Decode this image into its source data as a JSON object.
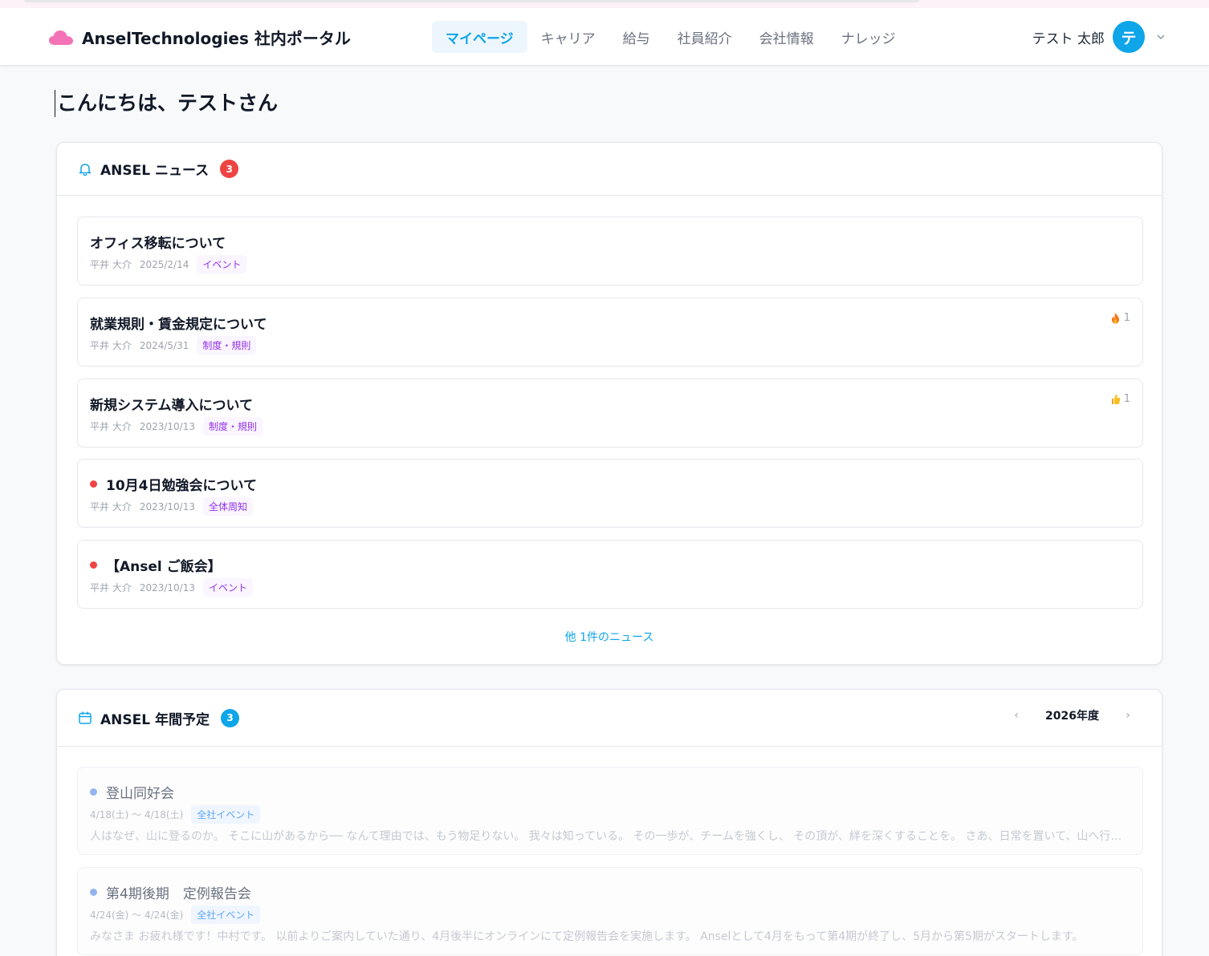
{
  "header": {
    "app_title": "AnselTechnologies 社内ポータル",
    "nav": [
      {
        "label": "マイページ",
        "active": true
      },
      {
        "label": "キャリア"
      },
      {
        "label": "給与"
      },
      {
        "label": "社員紹介"
      },
      {
        "label": "会社情報"
      },
      {
        "label": "ナレッジ"
      }
    ],
    "user_name": "テスト 太郎",
    "avatar_initial": "テ",
    "logo_icon": "cloud-icon",
    "accent_color": "#0ea5e9",
    "logo_color": "#f472b6"
  },
  "greeting": "こんにちは、テストさん",
  "news": {
    "title": "ANSEL ニュース",
    "badge": "3",
    "items": [
      {
        "title": "オフィス移転について",
        "author": "平井 大介",
        "date": "2025/2/14",
        "tag": "イベント",
        "unread": false,
        "reaction": null
      },
      {
        "title": "就業規則・賃金規定について",
        "author": "平井 大介",
        "date": "2024/5/31",
        "tag": "制度・規則",
        "unread": false,
        "reaction": {
          "icon": "fire-icon",
          "count": "1"
        }
      },
      {
        "title": "新規システム導入について",
        "author": "平井 大介",
        "date": "2023/10/13",
        "tag": "制度・規則",
        "unread": false,
        "reaction": {
          "icon": "thumbs-up-icon",
          "count": "1"
        }
      },
      {
        "title": "10月4日勉強会について",
        "author": "平井 大介",
        "date": "2023/10/13",
        "tag": "全体周知",
        "unread": true,
        "reaction": null
      },
      {
        "title": "【Ansel ご飯会】",
        "author": "平井 大介",
        "date": "2023/10/13",
        "tag": "イベント",
        "unread": true,
        "reaction": null
      }
    ],
    "more_label": "他 1件のニュース"
  },
  "schedule": {
    "title": "ANSEL 年間予定",
    "badge": "3",
    "year_label": "2026年度",
    "prev_label": "‹",
    "next_label": "›",
    "events": [
      {
        "title": "登山同好会",
        "period": "4/18(土) 〜 4/18(土)",
        "tag": "全社イベント",
        "description": "人はなぜ、山に登るのか。 そこに山があるから── なんて理由では、もう物足りない。 我々は知っている。 その一歩が、チームを強くし、 その頂が、絆を深くすることを。 さあ、日常を置いて、山へ行こう。"
      },
      {
        "title": "第4期後期　定例報告会",
        "period": "4/24(金) 〜 4/24(金)",
        "tag": "全社イベント",
        "description": "みなさま お疲れ様です！中村です。 以前よりご案内していた通り、4月後半にオンラインにて定例報告会を実施します。 Anselとして4月をもって第4期が終了し、5月から第5期がスタートします。"
      }
    ]
  }
}
